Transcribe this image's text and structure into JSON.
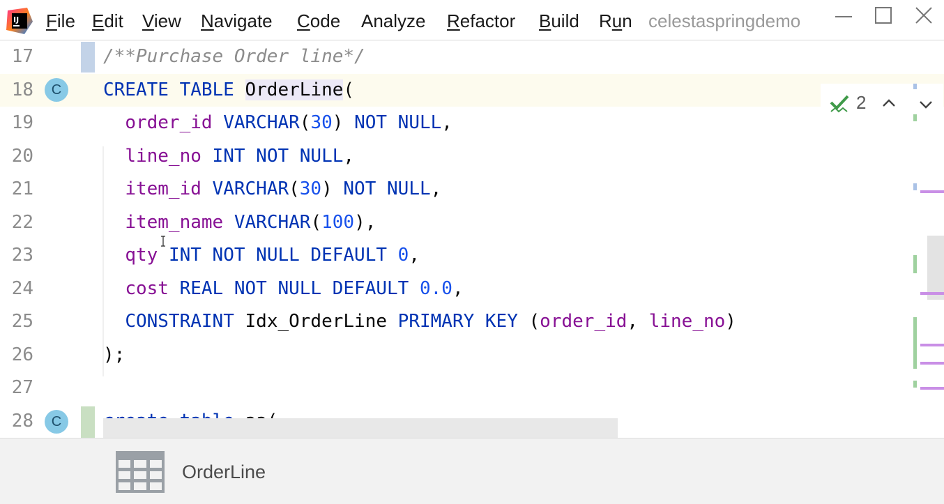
{
  "menu": {
    "items": [
      "File",
      "Edit",
      "View",
      "Navigate",
      "Code",
      "Analyze",
      "Refactor",
      "Build",
      "Run"
    ],
    "mnemonics": [
      "F",
      "E",
      "V",
      "N",
      "C",
      "",
      "R",
      "B",
      "u"
    ],
    "project_name": "celestaspringdemo"
  },
  "editor": {
    "line_numbers": [
      "17",
      "18",
      "19",
      "20",
      "21",
      "22",
      "23",
      "24",
      "25",
      "26",
      "27",
      "28"
    ],
    "current_line": "18",
    "table_badge_letter": "C",
    "lines": [
      "/**Purchase Order line*/",
      "CREATE TABLE OrderLine(",
      "  order_id VARCHAR(30) NOT NULL,",
      "  line_no INT NOT NULL,",
      "  item_id VARCHAR(30) NOT NULL,",
      "  item_name VARCHAR(100),",
      "  qty INT NOT NULL DEFAULT 0,",
      "  cost REAL NOT NULL DEFAULT 0.0,",
      "  CONSTRAINT Idx_OrderLine PRIMARY KEY (order_id, line_no)",
      ");",
      "",
      "create table aa("
    ]
  },
  "inspections": {
    "count": "2",
    "icon": "check-icon"
  },
  "breadcrumb": {
    "icon": "table-icon",
    "label": "OrderLine"
  },
  "colors": {
    "keyword": "#0033b3",
    "column": "#871094",
    "number": "#1750eb",
    "comment": "#8c8c8c",
    "current_line_bg": "#fdfbee",
    "badge": "#87c9e6",
    "vcs_added": "#c9dfc2",
    "vcs_modified": "#c3d3e8"
  }
}
